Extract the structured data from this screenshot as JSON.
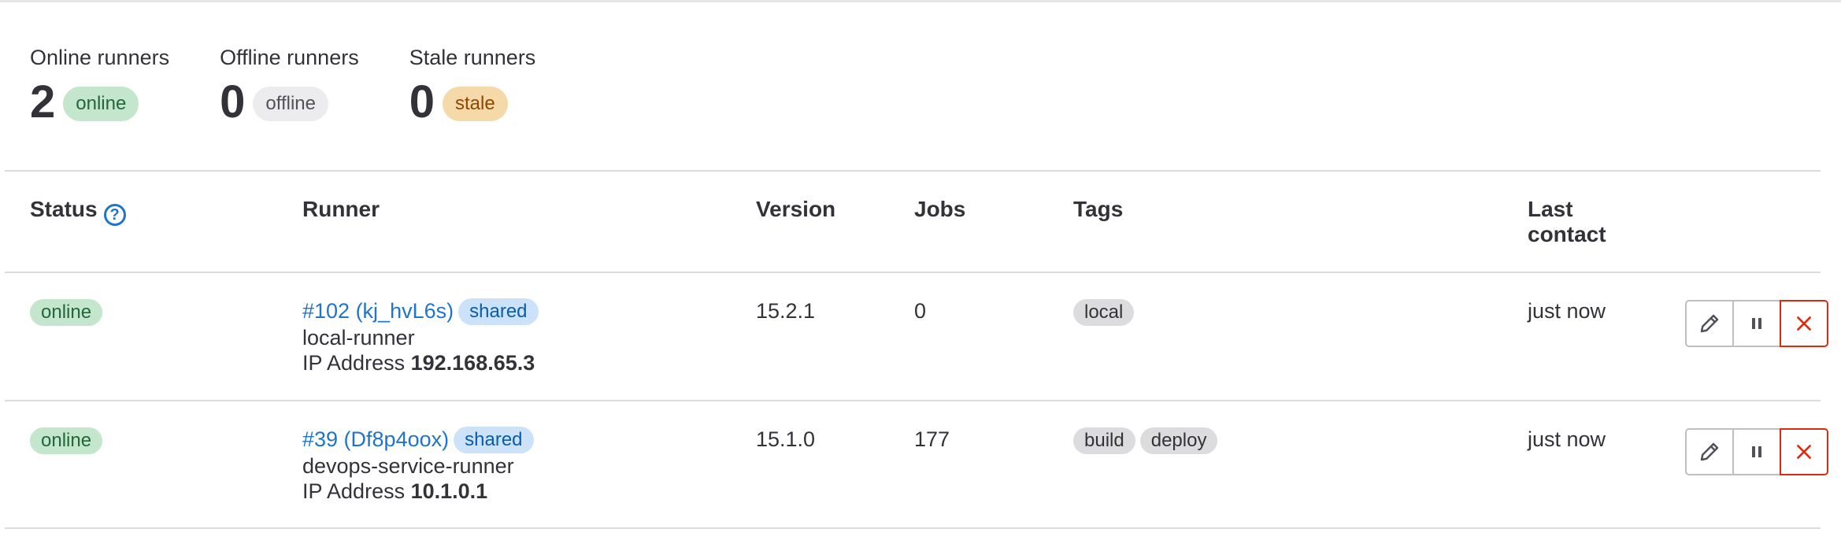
{
  "stats": [
    {
      "label": "Online runners",
      "value": "2",
      "badge": "online",
      "kind": "online"
    },
    {
      "label": "Offline runners",
      "value": "0",
      "badge": "offline",
      "kind": "offline"
    },
    {
      "label": "Stale runners",
      "value": "0",
      "badge": "stale",
      "kind": "stale"
    }
  ],
  "table": {
    "headers": {
      "status": "Status",
      "status_help_icon": "question-circle-icon",
      "runner": "Runner",
      "version": "Version",
      "jobs": "Jobs",
      "tags": "Tags",
      "last_contact_1": "Last",
      "last_contact_2": "contact"
    },
    "rows": [
      {
        "status": "online",
        "runner_link": "#102 (kj_hvL6s)",
        "type_badge": "shared",
        "description": "local-runner",
        "ip_label": "IP Address",
        "ip_value": "192.168.65.3",
        "version": "15.2.1",
        "jobs": "0",
        "tags": [
          "local"
        ],
        "last_contact": "just now"
      },
      {
        "status": "online",
        "runner_link": "#39 (Df8p4oox)",
        "type_badge": "shared",
        "description": "devops-service-runner",
        "ip_label": "IP Address",
        "ip_value": "10.1.0.1",
        "version": "15.1.0",
        "jobs": "177",
        "tags": [
          "build",
          "deploy"
        ],
        "last_contact": "just now"
      }
    ],
    "action_icons": [
      "pencil-icon",
      "pause-icon",
      "close-icon"
    ]
  },
  "colors": {
    "link": "#1f75cb",
    "online_bg": "#c3e6cd",
    "stale_bg": "#f5d9a8",
    "danger": "#dd2b0e"
  }
}
